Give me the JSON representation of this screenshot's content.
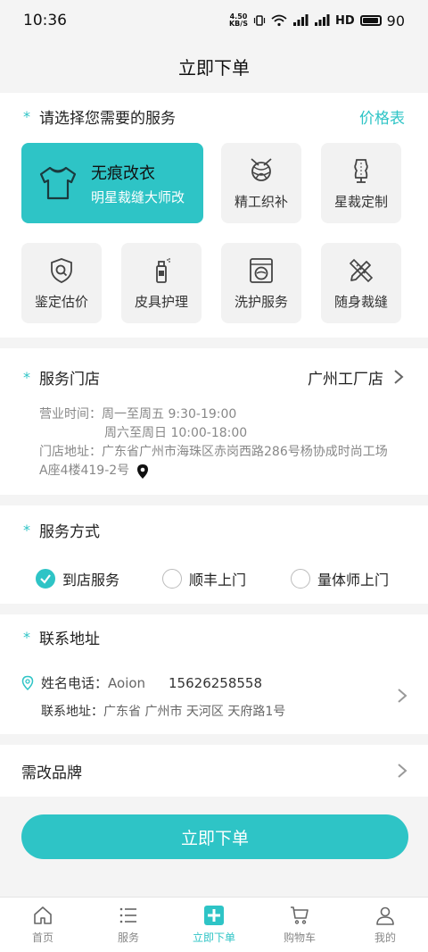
{
  "status": {
    "time": "10:36",
    "netspeed_top": "4.50",
    "netspeed_bottom": "KB/S",
    "network": "4G",
    "hd": "HD",
    "battery": "90"
  },
  "page_title": "立即下单",
  "services": {
    "title": "请选择您需要的服务",
    "price_link": "价格表",
    "primary": {
      "name": "无痕改衣",
      "sub": "明星裁缝大师改"
    },
    "items": [
      {
        "label": "精工织补",
        "icon": "yarn-needle-icon"
      },
      {
        "label": "星裁定制",
        "icon": "dress-form-icon"
      },
      {
        "label": "鉴定估价",
        "icon": "shield-search-icon"
      },
      {
        "label": "皮具护理",
        "icon": "spray-bottle-icon"
      },
      {
        "label": "洗护服务",
        "icon": "washing-machine-icon"
      },
      {
        "label": "随身裁缝",
        "icon": "pencil-ruler-icon"
      }
    ]
  },
  "store": {
    "title": "服务门店",
    "name": "广州工厂店",
    "hours_label": "营业时间：",
    "hours_weekday": "周一至周五 9:30-19:00",
    "hours_weekend": "周六至周日 10:00-18:00",
    "address_label": "门店地址：",
    "address_line1": "广东省广州市海珠区赤岗西路286号杨协成时尚工场",
    "address_line2": "A座4楼419-2号"
  },
  "service_mode": {
    "title": "服务方式",
    "options": [
      {
        "label": "到店服务",
        "checked": true
      },
      {
        "label": "顺丰上门",
        "checked": false
      },
      {
        "label": "量体师上门",
        "checked": false
      }
    ]
  },
  "contact": {
    "title": "联系地址",
    "name_label": "姓名电话：",
    "name": "Aoion",
    "phone": "15626258558",
    "address_label": "联系地址：",
    "address": "广东省 广州市 天河区 天府路1号"
  },
  "brand": {
    "label": "需改品牌"
  },
  "submit_label": "立即下单",
  "tabs": [
    {
      "label": "首页",
      "icon": "home-icon",
      "active": false
    },
    {
      "label": "服务",
      "icon": "list-icon",
      "active": false
    },
    {
      "label": "立即下单",
      "icon": "plus-square-icon",
      "active": true
    },
    {
      "label": "购物车",
      "icon": "cart-icon",
      "active": false
    },
    {
      "label": "我的",
      "icon": "user-icon",
      "active": false
    }
  ],
  "colors": {
    "accent": "#2ec4c6",
    "background": "#f4f4f4",
    "muted": "#888888"
  }
}
